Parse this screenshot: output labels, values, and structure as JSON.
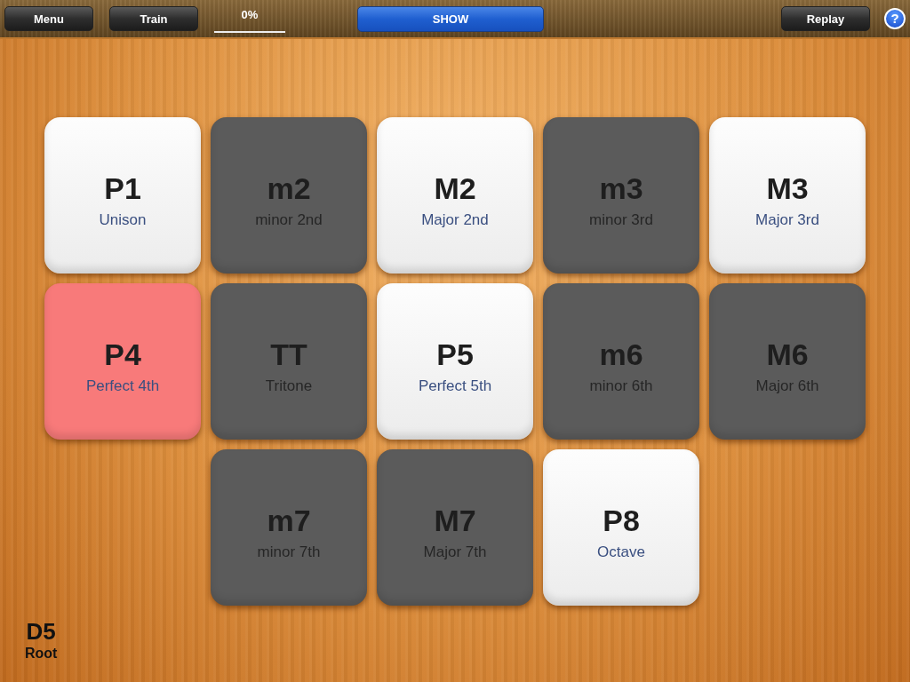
{
  "toolbar": {
    "buttons": [
      {
        "label": "Menu"
      },
      {
        "label": "Train"
      }
    ],
    "progress": "0%",
    "show_button": "SHOW",
    "replay_button": "Replay",
    "help_button": "?"
  },
  "rows": [
    [
      {
        "symbol": "P1",
        "name": "Unison",
        "kind": "light"
      },
      {
        "symbol": "m2",
        "name": "minor 2nd",
        "kind": "dark"
      },
      {
        "symbol": "M2",
        "name": "Major 2nd",
        "kind": "light"
      },
      {
        "symbol": "m3",
        "name": "minor 3rd",
        "kind": "dark"
      },
      {
        "symbol": "M3",
        "name": "Major 3rd",
        "kind": "light"
      }
    ],
    [
      {
        "symbol": "P4",
        "name": "Perfect 4th",
        "kind": "red"
      },
      {
        "symbol": "TT",
        "name": "Tritone",
        "kind": "dark"
      },
      {
        "symbol": "P5",
        "name": "Perfect 5th",
        "kind": "light"
      },
      {
        "symbol": "m6",
        "name": "minor 6th",
        "kind": "dark"
      },
      {
        "symbol": "M6",
        "name": "Major 6th",
        "kind": "dark"
      }
    ],
    [
      {
        "symbol": "m7",
        "name": "minor 7th",
        "kind": "dark"
      },
      {
        "symbol": "M7",
        "name": "Major 7th",
        "kind": "dark"
      },
      {
        "symbol": "P8",
        "name": "Octave",
        "kind": "light"
      }
    ]
  ],
  "root": {
    "note": "D5",
    "label": "Root"
  }
}
